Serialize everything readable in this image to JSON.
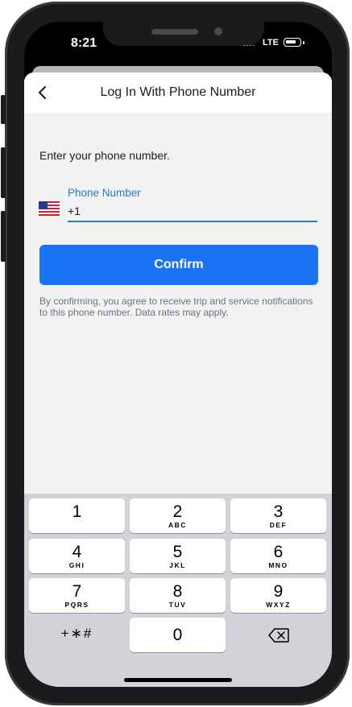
{
  "status_bar": {
    "time": "8:21",
    "signal": "....",
    "network": "LTE"
  },
  "header": {
    "title": "Log In With Phone Number",
    "back_icon": "chevron-left-icon"
  },
  "form": {
    "prompt": "Enter your phone number.",
    "country_flag": "us-flag-icon",
    "field_label": "Phone Number",
    "phone_value": "+1",
    "confirm_label": "Confirm",
    "disclaimer": "By confirming, you agree to receive trip and service notifications to this phone number. Data rates may apply."
  },
  "keyboard": {
    "keys": [
      {
        "digit": "1",
        "letters": ""
      },
      {
        "digit": "2",
        "letters": "ABC"
      },
      {
        "digit": "3",
        "letters": "DEF"
      },
      {
        "digit": "4",
        "letters": "GHI"
      },
      {
        "digit": "5",
        "letters": "JKL"
      },
      {
        "digit": "6",
        "letters": "MNO"
      },
      {
        "digit": "7",
        "letters": "PQRS"
      },
      {
        "digit": "8",
        "letters": "TUV"
      },
      {
        "digit": "9",
        "letters": "WXYZ"
      }
    ],
    "symbols": "+∗#",
    "zero": "0",
    "delete_icon": "backspace-icon"
  },
  "colors": {
    "accent": "#1a73f2",
    "label_blue": "#2a7bc0",
    "background": "#f2f2f2"
  }
}
